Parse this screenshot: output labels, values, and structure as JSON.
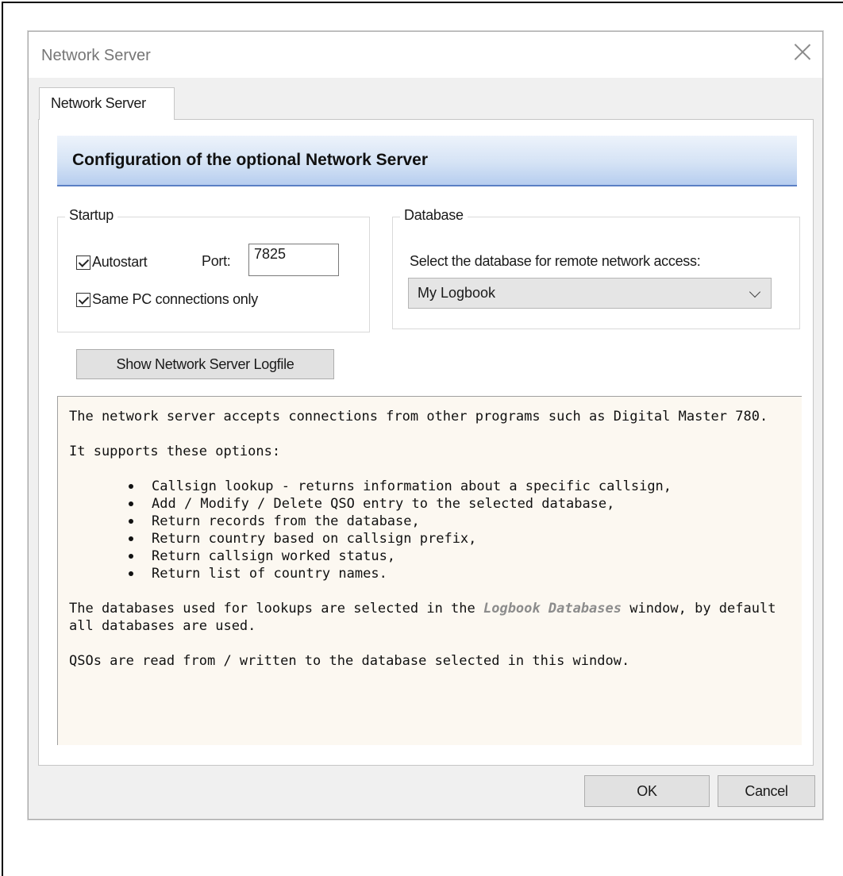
{
  "window": {
    "title": "Network Server"
  },
  "tab": {
    "label": "Network Server"
  },
  "banner": {
    "heading": "Configuration of the optional Network Server"
  },
  "startup": {
    "group_label": "Startup",
    "autostart_label": "Autostart",
    "autostart_checked": true,
    "port_label": "Port:",
    "port_value": "7825",
    "same_pc_label": "Same PC connections only",
    "same_pc_checked": true
  },
  "database": {
    "group_label": "Database",
    "prompt": "Select the database for remote network access:",
    "selected": "My Logbook"
  },
  "logfile_button": "Show Network Server Logfile",
  "info": {
    "para1": "The network server accepts connections from other programs such as Digital Master 780.",
    "para2": "It supports these options:",
    "options": [
      "Callsign lookup - returns information about a specific callsign,",
      "Add / Modify / Delete QSO entry to the selected database,",
      "Return records from the database,",
      "Return country based on callsign prefix,",
      "Return callsign worked status,",
      "Return list of country names."
    ],
    "para3_before": "The databases used for lookups are selected in the ",
    "para3_link": "Logbook Databases",
    "para3_after": " window, by default all databases are used.",
    "para4": "QSOs are read from / written to the database selected in this window."
  },
  "footer": {
    "ok": "OK",
    "cancel": "Cancel"
  }
}
